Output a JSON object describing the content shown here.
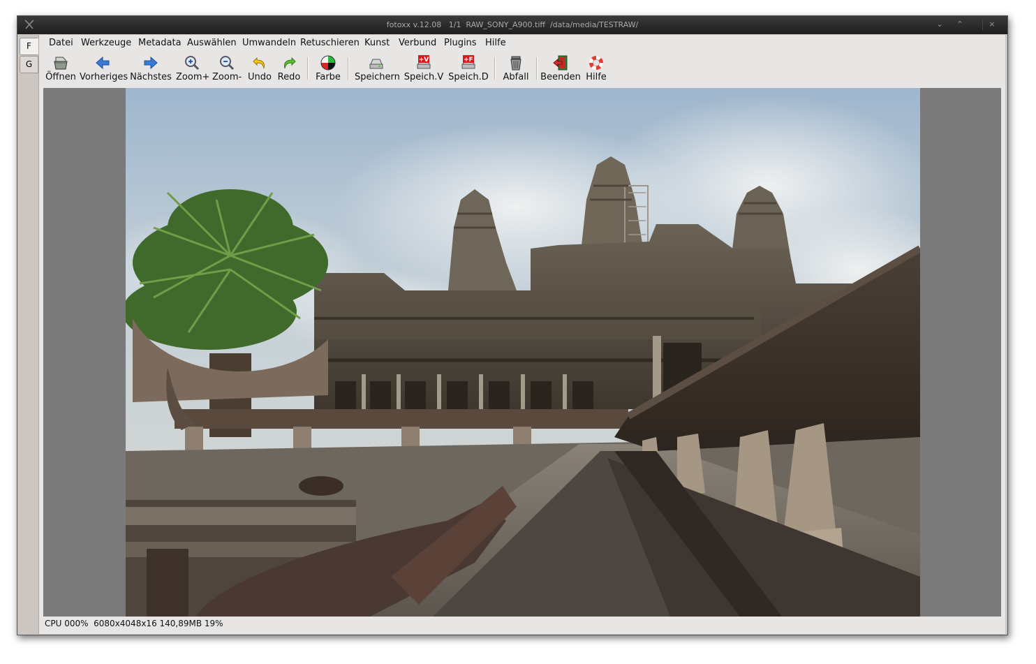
{
  "window": {
    "title": "fotoxx v.12.08   1/1  RAW_SONY_A900.tiff  /data/media/TESTRAW/",
    "controls": {
      "minimize": "⌄",
      "maximize": "⌃",
      "close": "×"
    }
  },
  "side_tabs": [
    "F",
    "G"
  ],
  "menu": [
    "Datei",
    "Werkzeuge",
    "Metadata",
    "Auswählen",
    "Umwandeln",
    "Retuschieren",
    "Kunst",
    "Verbund",
    "Plugins",
    "Hilfe"
  ],
  "toolbar": {
    "open": "Öffnen",
    "prev": "Vorheriges",
    "next": "Nächstes",
    "zoom_in": "Zoom+",
    "zoom_out": "Zoom-",
    "undo": "Undo",
    "redo": "Redo",
    "color": "Farbe",
    "save": "Speichern",
    "save_v": "Speich.V",
    "save_v_badge": "+V",
    "save_d": "Speich.D",
    "save_d_badge": "+F",
    "trash": "Abfall",
    "quit": "Beenden",
    "help": "Hilfe"
  },
  "status": "CPU 000%  6080x4048x16 140,89MB 19%"
}
